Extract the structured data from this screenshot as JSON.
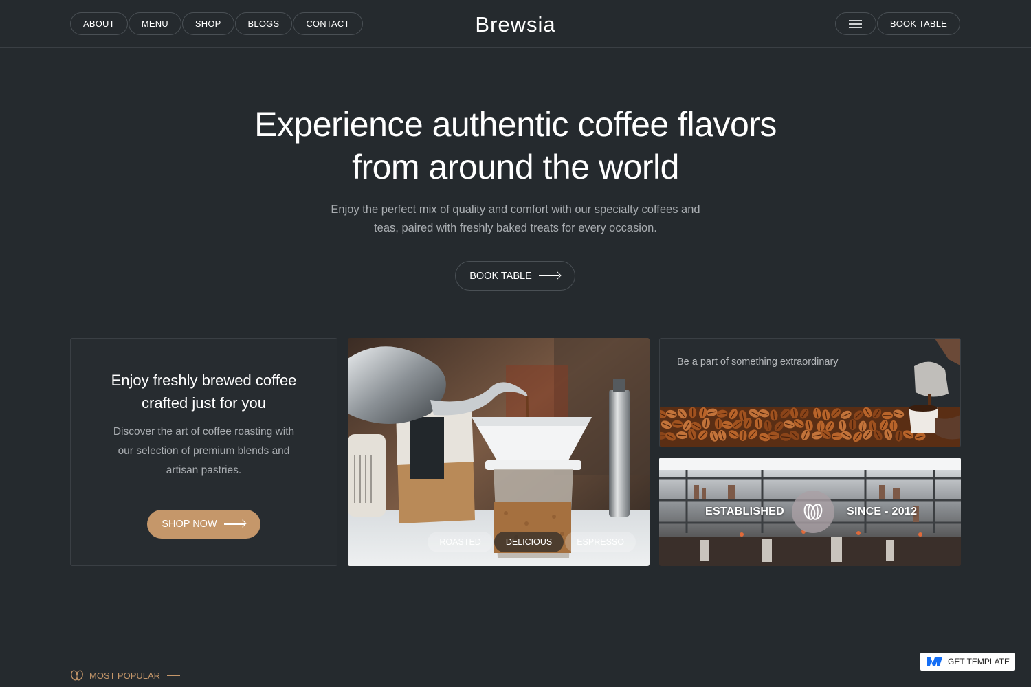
{
  "header": {
    "nav_left": [
      "ABOUT",
      "MENU",
      "SHOP",
      "BLOGS",
      "CONTACT"
    ],
    "logo": "Brewsia",
    "book_table": "BOOK TABLE",
    "menu_icon": "hamburger-icon"
  },
  "hero": {
    "title_line1": "Experience authentic coffee flavors",
    "title_line2": "from around the world",
    "subtitle_line1": "Enjoy the perfect mix of quality and comfort with our specialty coffees and",
    "subtitle_line2": "teas, paired with freshly baked treats for every occasion.",
    "cta": "BOOK TABLE"
  },
  "card_intro": {
    "title_line1": "Enjoy freshly brewed coffee",
    "title_line2": "crafted just for you",
    "text_line1": "Discover the art of coffee roasting with",
    "text_line2": "our selection of premium blends and",
    "text_line3": "artisan pastries.",
    "cta": "SHOP NOW"
  },
  "card_photo": {
    "tags": [
      "ROASTED",
      "DELICIOUS",
      "ESPRESSO"
    ]
  },
  "card_beans": {
    "text": "Be a part of something extraordinary"
  },
  "card_cafe": {
    "left": "ESTABLISHED",
    "right": "SINCE - 2012"
  },
  "section": {
    "label": "MOST POPULAR"
  },
  "footer_badge": {
    "label": "GET TEMPLATE"
  },
  "colors": {
    "background": "#252a2e",
    "accent": "#c5976a",
    "border": "#4a5055",
    "muted_text": "#a9adb1"
  }
}
